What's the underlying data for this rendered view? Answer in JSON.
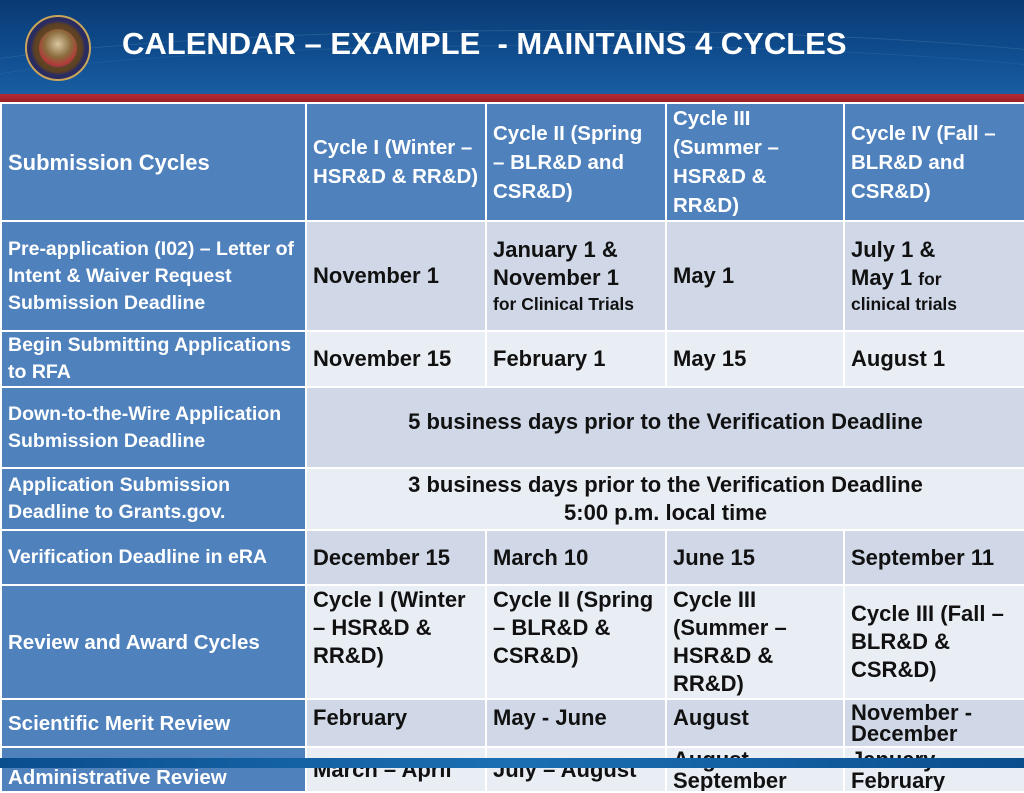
{
  "slide": {
    "title": "CALENDAR – EXAMPLE  - MAINTAINS 4 CYCLES",
    "logo": "va-seal-icon"
  },
  "table": {
    "header": {
      "row_label": "Submission Cycles",
      "cycles": [
        "Cycle I (Winter – HSR&D  & RR&D)",
        "Cycle II (Spring – BLR&D and CSR&D)",
        "Cycle III (Summer – HSR&D & RR&D)",
        "Cycle IV (Fall – BLR&D and CSR&D)"
      ]
    },
    "rows": {
      "pre_application": {
        "label": "Pre-application (I02) – Letter of Intent & Waiver Request Submission Deadline",
        "c1": "November 1",
        "c2_main": "January 1 & November 1",
        "c2_note": "for Clinical Trials",
        "c3": "May 1",
        "c4_main1": "July 1 &",
        "c4_main2": "May 1",
        "c4_note1": "for",
        "c4_note2": "clinical trials"
      },
      "begin_submitting": {
        "label": "Begin Submitting Applications to RFA",
        "c1": "November 15",
        "c2": "February 1",
        "c3": "May 15",
        "c4": "August 1"
      },
      "down_to_wire": {
        "label": "Down-to-the-Wire Application Submission Deadline",
        "value": "5 business days prior to the Verification Deadline"
      },
      "grants_gov": {
        "label": "Application Submission Deadline to Grants.gov.",
        "value_line1": "3 business days prior to the Verification Deadline",
        "value_line2": "5:00 p.m. local time"
      },
      "verification": {
        "label": "Verification Deadline in eRA",
        "c1": "December 15",
        "c2": "March 10",
        "c3": "June 15",
        "c4": "September 11"
      },
      "review_award": {
        "label": "Review and Award Cycles",
        "c1": "Cycle I (Winter – HSR&D & RR&D)",
        "c2": "Cycle II (Spring – BLR&D & CSR&D)",
        "c3": "Cycle III (Summer – HSR&D & RR&D)",
        "c4": "Cycle III (Fall – BLR&D & CSR&D)"
      },
      "scientific_merit": {
        "label": "Scientific Merit Review",
        "c1": "February",
        "c2": "May - June",
        "c3": "August",
        "c4": "November - December"
      },
      "administrative": {
        "label": "Administrative Review",
        "c1": "March – April",
        "c2": "July – August",
        "c3": "August – September",
        "c4": "January - February"
      }
    }
  },
  "colors": {
    "header_blue": "#0f4d8f",
    "accent_red": "#9c1f28",
    "row_header_blue": "#4f81bd",
    "cell_dark": "#d0d8e8",
    "cell_light": "#e9edf4"
  }
}
